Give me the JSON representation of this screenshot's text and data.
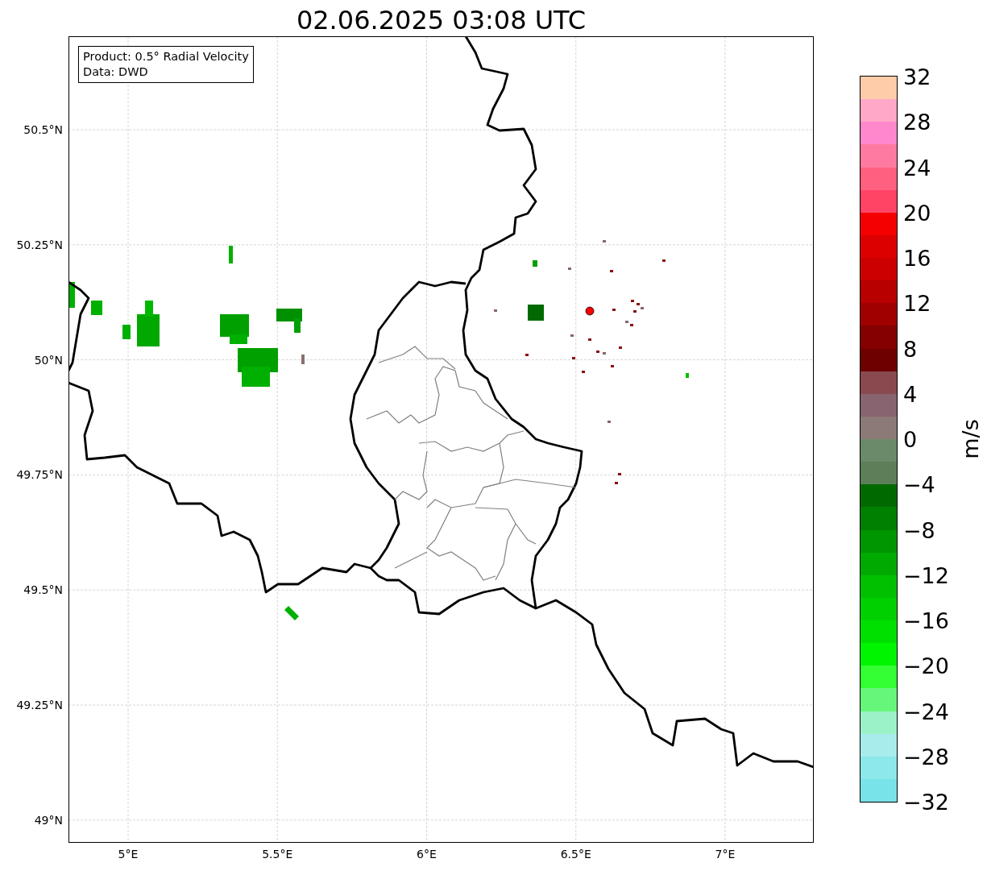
{
  "title": "02.06.2025 03:08 UTC",
  "info_box": {
    "lines": [
      "Product: 0.5° Radial Velocity",
      "Data: DWD"
    ]
  },
  "map": {
    "lat_labels": [
      "50.5°N",
      "50.25°N",
      "50°N",
      "49.75°N",
      "49.5°N",
      "49.25°N",
      "49°N"
    ],
    "lon_labels": [
      "5°E",
      "5.5°E",
      "6°E",
      "6.5°E",
      "7°E"
    ]
  },
  "colorbar": {
    "label": "m/s",
    "ticks": [
      "32",
      "28",
      "24",
      "20",
      "16",
      "12",
      "8",
      "4",
      "0",
      "−4",
      "−8",
      "−12",
      "−16",
      "−20",
      "−24",
      "−28",
      "−32"
    ],
    "bands": [
      {
        "color": "#78e3e8"
      },
      {
        "color": "#8ce8ea"
      },
      {
        "color": "#a8ecec"
      },
      {
        "color": "#9cf2c8"
      },
      {
        "color": "#66f77a"
      },
      {
        "color": "#33ff33"
      },
      {
        "color": "#00f500"
      },
      {
        "color": "#00e000"
      },
      {
        "color": "#00d000"
      },
      {
        "color": "#00c000"
      },
      {
        "color": "#00aa00"
      },
      {
        "color": "#009600"
      },
      {
        "color": "#008000"
      },
      {
        "color": "#006a00"
      },
      {
        "color": "#5c7f59"
      },
      {
        "color": "#6a8a6a"
      },
      {
        "color": "#8c7a76"
      },
      {
        "color": "#886470"
      },
      {
        "color": "#884a4e"
      },
      {
        "color": "#6e0000"
      },
      {
        "color": "#850000"
      },
      {
        "color": "#a00000"
      },
      {
        "color": "#b80000"
      },
      {
        "color": "#cc0000"
      },
      {
        "color": "#dd0000"
      },
      {
        "color": "#f50000"
      },
      {
        "color": "#ff4466"
      },
      {
        "color": "#ff6080"
      },
      {
        "color": "#ff7aa0"
      },
      {
        "color": "#ff88cc"
      },
      {
        "color": "#ffa8c8"
      },
      {
        "color": "#ffccaa"
      }
    ]
  }
}
